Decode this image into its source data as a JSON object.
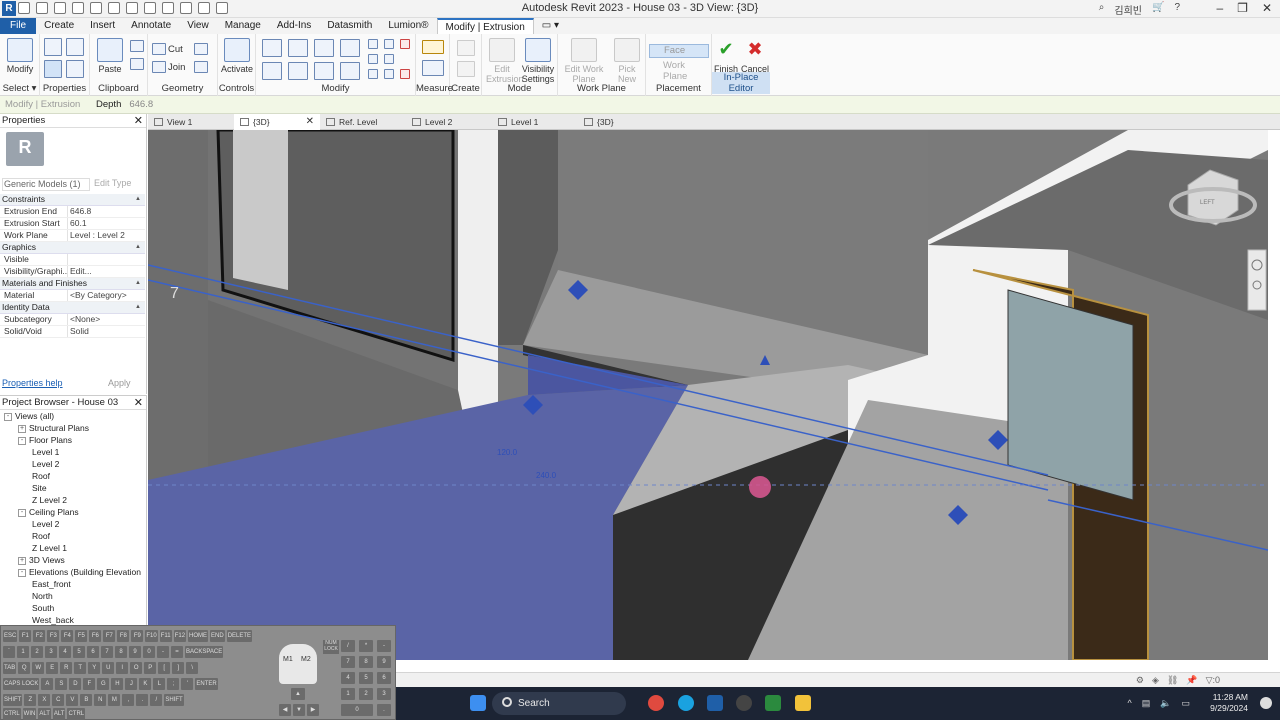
{
  "app": {
    "title": "Autodesk Revit 2023 - House 03 - 3D View: {3D}",
    "logo": "R",
    "user": "김희빈"
  },
  "ribbon_tabs": [
    "File",
    "Create",
    "Insert",
    "Annotate",
    "View",
    "Manage",
    "Add-Ins",
    "Datasmith",
    "Lumion®",
    "Modify | Extrusion"
  ],
  "ribbon": {
    "modify_label": "Modify",
    "select_label": "Select ▾",
    "properties_label": "Properties",
    "paste_label": "Paste",
    "cut_label": "Cut",
    "join_label": "Join",
    "clipboard_label": "Clipboard",
    "geometry_label": "Geometry",
    "activate_label": "Activate",
    "controls_label": "Controls",
    "modify_group_label": "Modify",
    "measure_label": "Measure",
    "create_label": "Create",
    "edit_extrusion_label": "Edit Extrusion",
    "visibility_settings_label": "Visibility Settings",
    "mode_label": "Mode",
    "edit_work_plane_label": "Edit Work Plane",
    "pick_new_label": "Pick New",
    "work_plane_group_label": "Work Plane",
    "face_label": "Face",
    "work_plane_label": "Work Plane",
    "placement_label": "Placement",
    "finish_model_label": "Finish Model",
    "cancel_model_label": "Cancel Model",
    "in_place_editor_label": "In-Place Editor"
  },
  "options_bar": {
    "context": "Modify | Extrusion",
    "depth_label": "Depth",
    "depth_value": "646.8"
  },
  "properties": {
    "header": "Properties",
    "type": "Generic Models (1)",
    "edit_type": "Edit Type",
    "sections": [
      {
        "name": "Constraints",
        "rows": [
          [
            "Extrusion End",
            "646.8"
          ],
          [
            "Extrusion Start",
            "60.1"
          ],
          [
            "Work Plane",
            "Level : Level 2"
          ]
        ]
      },
      {
        "name": "Graphics",
        "rows": [
          [
            "Visible",
            ""
          ],
          [
            "Visibility/Graphi...",
            "Edit..."
          ]
        ]
      },
      {
        "name": "Materials and Finishes",
        "rows": [
          [
            "Material",
            "<By Category>"
          ]
        ]
      },
      {
        "name": "Identity Data",
        "rows": [
          [
            "Subcategory",
            "<None>"
          ],
          [
            "Solid/Void",
            "Solid"
          ]
        ]
      }
    ],
    "help": "Properties help",
    "apply": "Apply"
  },
  "project_browser": {
    "header": "Project Browser - House 03",
    "items": [
      {
        "label": "Views (all)",
        "level": 0,
        "toggle": "-"
      },
      {
        "label": "Structural Plans",
        "level": 1,
        "toggle": "+"
      },
      {
        "label": "Floor Plans",
        "level": 1,
        "toggle": "-"
      },
      {
        "label": "Level 1",
        "level": 2,
        "toggle": ""
      },
      {
        "label": "Level 2",
        "level": 2,
        "toggle": ""
      },
      {
        "label": "Roof",
        "level": 2,
        "toggle": ""
      },
      {
        "label": "Site",
        "level": 2,
        "toggle": ""
      },
      {
        "label": "Z Level 2",
        "level": 2,
        "toggle": ""
      },
      {
        "label": "Ceiling Plans",
        "level": 1,
        "toggle": "-"
      },
      {
        "label": "Level 2",
        "level": 2,
        "toggle": ""
      },
      {
        "label": "Roof",
        "level": 2,
        "toggle": ""
      },
      {
        "label": "Z Level 1",
        "level": 2,
        "toggle": ""
      },
      {
        "label": "3D Views",
        "level": 1,
        "toggle": "+"
      },
      {
        "label": "Elevations (Building Elevation",
        "level": 1,
        "toggle": "-"
      },
      {
        "label": "East_front",
        "level": 2,
        "toggle": ""
      },
      {
        "label": "North",
        "level": 2,
        "toggle": ""
      },
      {
        "label": "South",
        "level": 2,
        "toggle": ""
      },
      {
        "label": "West_back",
        "level": 2,
        "toggle": ""
      }
    ]
  },
  "view_tabs": [
    {
      "label": "View 1",
      "active": false
    },
    {
      "label": "{3D}",
      "active": true
    },
    {
      "label": "Ref. Level",
      "active": false
    },
    {
      "label": "Level 2",
      "active": false
    },
    {
      "label": "Level 1",
      "active": false
    },
    {
      "label": "{3D}",
      "active": false
    }
  ],
  "viewport": {
    "dim_1": "120.0",
    "dim_2": "240.0",
    "grid_tag": "7",
    "viewcube_label": "LEFT"
  },
  "status": {
    "filter_count": ":0"
  },
  "taskbar": {
    "search": "Search",
    "time": "11:28 AM",
    "date": "9/29/2024"
  },
  "keyboard": {
    "rows": [
      [
        "ESC",
        "F1",
        "F2",
        "F3",
        "F4",
        "F5",
        "F6",
        "F7",
        "F8",
        "F9",
        "F10",
        "F11",
        "F12",
        "HOME",
        "END",
        "DELETE"
      ],
      [
        "`",
        "1",
        "2",
        "3",
        "4",
        "5",
        "6",
        "7",
        "8",
        "9",
        "0",
        "-",
        "=",
        "BACKSPACE"
      ],
      [
        "TAB",
        "Q",
        "W",
        "E",
        "R",
        "T",
        "Y",
        "U",
        "I",
        "O",
        "P",
        "[",
        "]",
        "\\"
      ],
      [
        "CAPS LOCK",
        "A",
        "S",
        "D",
        "F",
        "G",
        "H",
        "J",
        "K",
        "L",
        ";",
        "'",
        "ENTER"
      ],
      [
        "SHIFT",
        "Z",
        "X",
        "C",
        "V",
        "B",
        "N",
        "M",
        ",",
        ".",
        "/",
        "SHIFT"
      ],
      [
        "CTRL",
        "WIN",
        "ALT",
        "ALT",
        "CTRL"
      ]
    ],
    "mouse_left": "M1",
    "mouse_right": "M2",
    "numlock": "NUM LOCK"
  }
}
